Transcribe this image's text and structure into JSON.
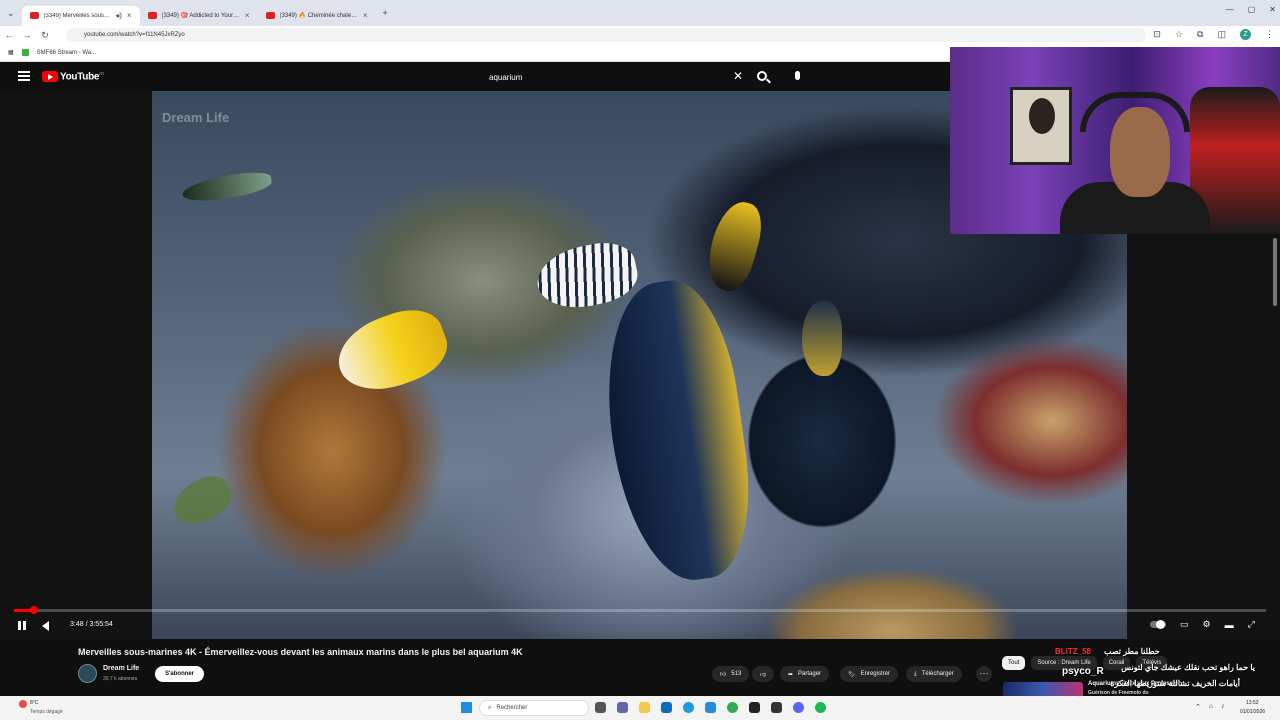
{
  "browser": {
    "tabs": [
      {
        "label": "(3349) Merveilles sous-mar..."
      },
      {
        "label": "(3349) 🎯 Addicted to Your Fl..."
      },
      {
        "label": "(3349) 🔥 Cheminée chaleureu..."
      }
    ],
    "new_tab_label": "+",
    "url": "youtube.com/watch?v=f11N45JxRZyo",
    "bookmark_label": "SMF66 Stream - Wa..."
  },
  "youtube": {
    "logo_text": "YouTube",
    "logo_suffix": "FR",
    "search_value": "aquarium",
    "watermark": "Dream Life"
  },
  "player": {
    "time_text": "3:48 / 3:55:54",
    "progress_fraction": 0.016
  },
  "video": {
    "title": "Merveilles sous-marines 4K - Émerveillez-vous devant les animaux marins dans le plus bel aquarium 4K",
    "channel_name": "Dream Life",
    "subscribers": "30,7 k abonnés",
    "subscribe_label": "S'abonner",
    "like_count": "513",
    "share_label": "Partager",
    "save_label": "Enregistrer",
    "download_label": "Télécharger"
  },
  "chips": [
    "Tout",
    "Source : Dream Life",
    "Corail",
    "Télévis"
  ],
  "chat": [
    {
      "text": "BLITZ_58",
      "color": "#ff3030"
    },
    {
      "text": "حطلنا مطر تصب",
      "color": "#ffffff"
    },
    {
      "text": "يا حما راهو تحب نقلك عيشك جاي لتونس",
      "color": "#ffffff"
    },
    {
      "text": "psyco_R",
      "color": "#ffffff"
    },
    {
      "text": "Aquariums Tropicaux Profession",
      "color": "#ffffff"
    },
    {
      "text": "أيامات الخريف تشالله ستوريطها الفكرة",
      "color": "#ffffff"
    },
    {
      "text": "Guérison de Freemolo du",
      "color": "#ffffff"
    }
  ],
  "taskbar": {
    "weather_temp": "8°C",
    "weather_desc": "Temps dégagé",
    "search_placeholder": "Rechercher",
    "time": "13:52",
    "date": "01/01/2026"
  }
}
